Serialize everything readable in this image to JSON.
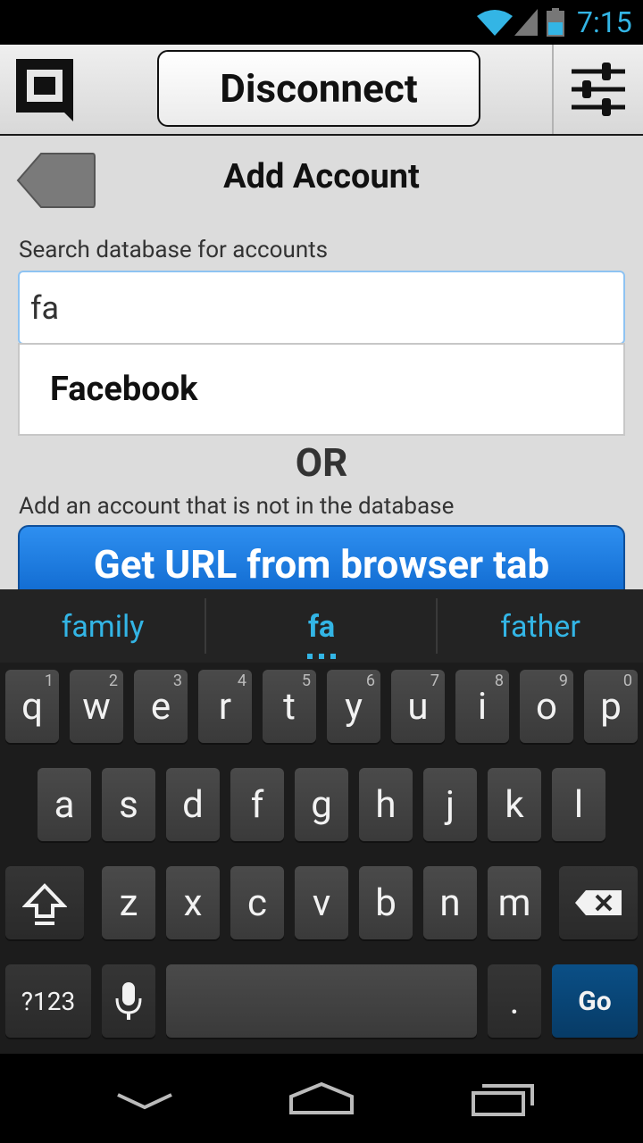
{
  "status_bar": {
    "time": "7:15"
  },
  "header": {
    "disconnect_label": "Disconnect"
  },
  "page": {
    "title": "Add Account",
    "search_label": "Search database for accounts",
    "search_value": "fa",
    "suggestion": "Facebook",
    "or_label": "OR",
    "add_label": "Add an account that is not in the database",
    "get_url_label": "Get URL from browser tab"
  },
  "keyboard": {
    "suggestions": [
      "family",
      "fa",
      "father"
    ],
    "row1": [
      {
        "k": "q",
        "n": "1"
      },
      {
        "k": "w",
        "n": "2"
      },
      {
        "k": "e",
        "n": "3"
      },
      {
        "k": "r",
        "n": "4"
      },
      {
        "k": "t",
        "n": "5"
      },
      {
        "k": "y",
        "n": "6"
      },
      {
        "k": "u",
        "n": "7"
      },
      {
        "k": "i",
        "n": "8"
      },
      {
        "k": "o",
        "n": "9"
      },
      {
        "k": "p",
        "n": "0"
      }
    ],
    "row2": [
      "a",
      "s",
      "d",
      "f",
      "g",
      "h",
      "j",
      "k",
      "l"
    ],
    "row3": [
      "z",
      "x",
      "c",
      "v",
      "b",
      "n",
      "m"
    ],
    "sym_label": "?123",
    "period": ".",
    "go_label": "Go"
  },
  "icons": {
    "status": [
      "wifi-icon",
      "signal-icon",
      "battery-icon"
    ],
    "app": [
      "logo-icon",
      "settings-sliders-icon",
      "back-arrow-icon"
    ],
    "keyboard": [
      "shift-icon",
      "backspace-icon",
      "mic-icon"
    ],
    "nav": [
      "nav-back-icon",
      "nav-home-icon",
      "nav-recents-icon"
    ]
  },
  "colors": {
    "accent": "#33b5e5",
    "button_blue": "#0d66cc",
    "go_key": "#0a4f86"
  }
}
